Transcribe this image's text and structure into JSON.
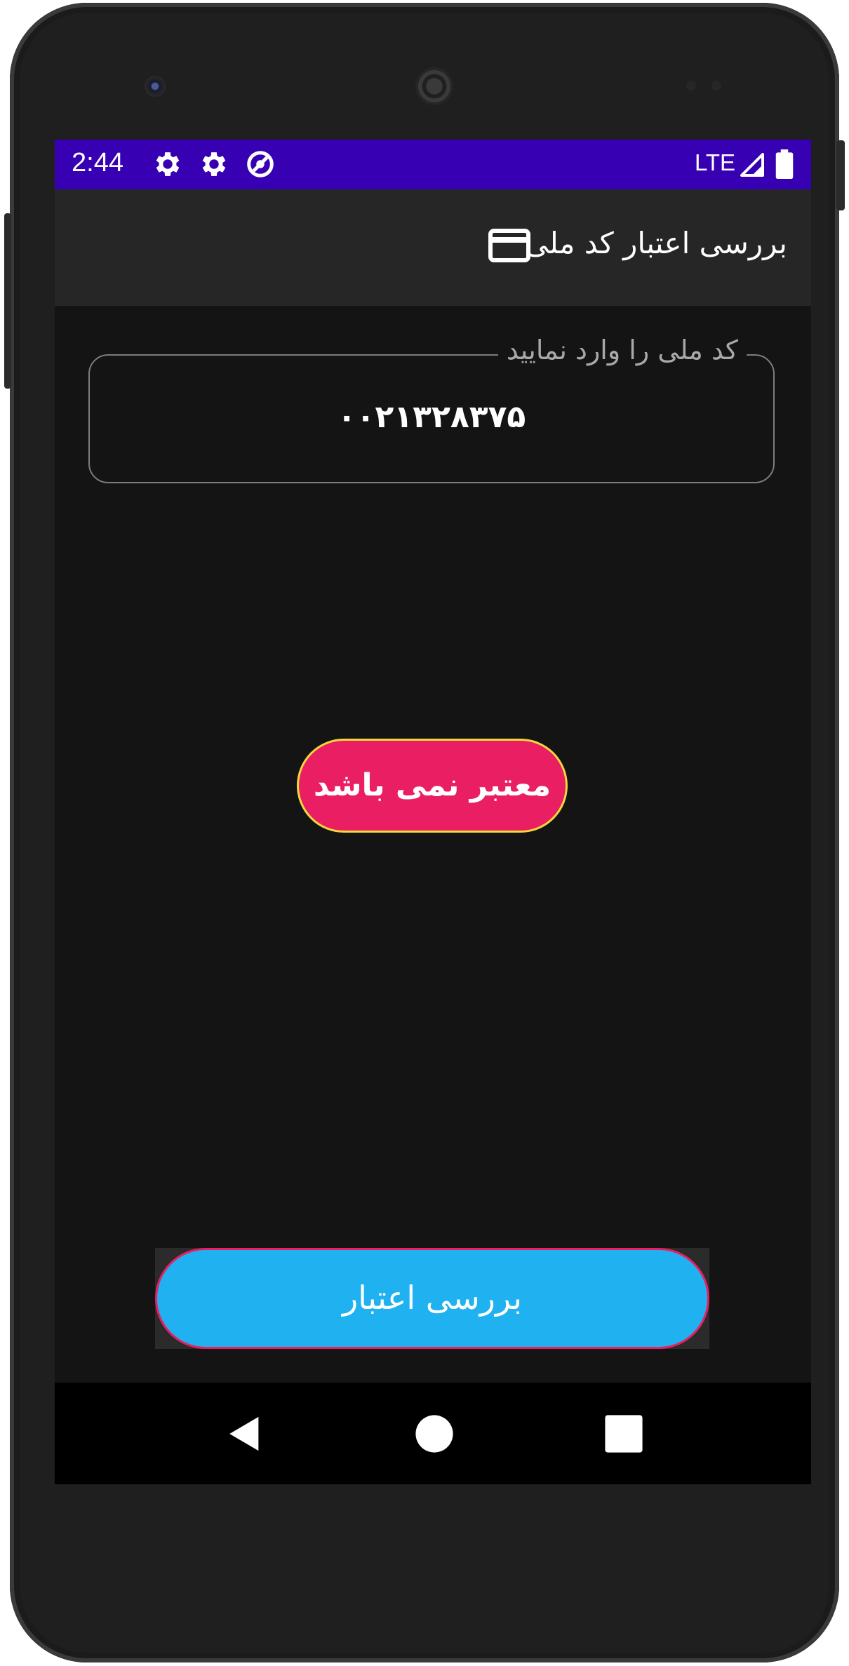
{
  "status_bar": {
    "time": "2:44",
    "left_icons": [
      "settings-icon",
      "settings-icon",
      "data-saver-icon"
    ],
    "network": "LTE",
    "right_icons": [
      "signal-icon",
      "battery-icon"
    ],
    "background": "#3700b3"
  },
  "app_bar": {
    "title": "بررسی اعتبار کد ملی",
    "icon": "credit-card-icon",
    "background": "#262626"
  },
  "national_code_input": {
    "label": "کد ملی را وارد نمایید",
    "value": "۰۰۲۱۳۲۸۳۷۵"
  },
  "result": {
    "text": "معتبر نمی باشد",
    "background": "#e91e63",
    "border": "#f2d83b"
  },
  "check_button": {
    "label": "بررسی اعتبار",
    "background": "#20b2f0",
    "border": "#e91e63"
  },
  "nav_bar": {
    "buttons": [
      "back-icon",
      "home-icon",
      "recents-icon"
    ]
  }
}
